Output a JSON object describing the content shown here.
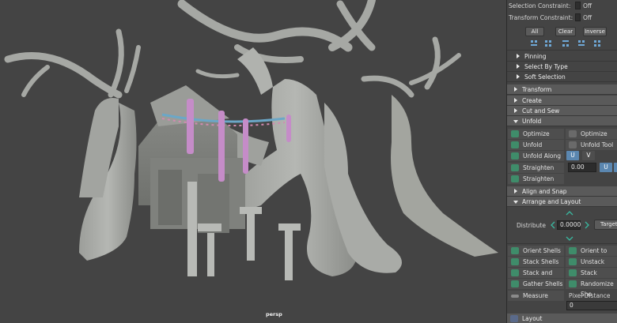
{
  "viewport": {
    "camera_label": "persp"
  },
  "panel": {
    "selection_constraint": {
      "label": "Selection Constraint:",
      "value": "Off"
    },
    "transform_constraint": {
      "label": "Transform Constraint:",
      "value": "Off"
    },
    "buttons": {
      "all": "All",
      "clear": "Clear",
      "inverse": "Inverse"
    },
    "subsections": [
      "Pinning",
      "Select By Type",
      "Soft Selection"
    ],
    "sections": {
      "transform": "Transform",
      "create": "Create",
      "cut_and_sew": "Cut and Sew",
      "unfold": "Unfold"
    },
    "unfold_tools": {
      "optimize": "Optimize",
      "optimize_tool": "Optimize Tool",
      "unfold": "Unfold",
      "unfold_tool": "Unfold Tool",
      "unfold_along": "Unfold Along",
      "u": "U",
      "v": "V",
      "straighten_uvs": "Straighten UVs",
      "straighten_value": "0.00",
      "u2": "U",
      "straighten_shell": "Straighten Shell"
    },
    "align_and_snap": "Align and Snap",
    "arrange_and_layout": "Arrange and Layout",
    "distribute": {
      "label": "Distribute",
      "value": "0.0000",
      "target": "Target"
    },
    "arrange_tools": {
      "orient_shells": "Orient Shells",
      "orient_to_edges": "Orient to Edges",
      "stack_shells": "Stack Shells",
      "unstack_shells": "Unstack Shells",
      "stack_and_orient": "Stack and Orient",
      "stack_similar": "Stack Similar",
      "gather_shells": "Gather Shells",
      "randomize_shells": "Randomize She"
    },
    "measure": {
      "label": "Measure",
      "pixel_distance": "Pixel Distance",
      "value": "0"
    },
    "layout": "Layout"
  },
  "colors": {
    "accent_blue": "#5b87b0",
    "panel_bg": "#444444",
    "viewport_bg": "#444444"
  }
}
